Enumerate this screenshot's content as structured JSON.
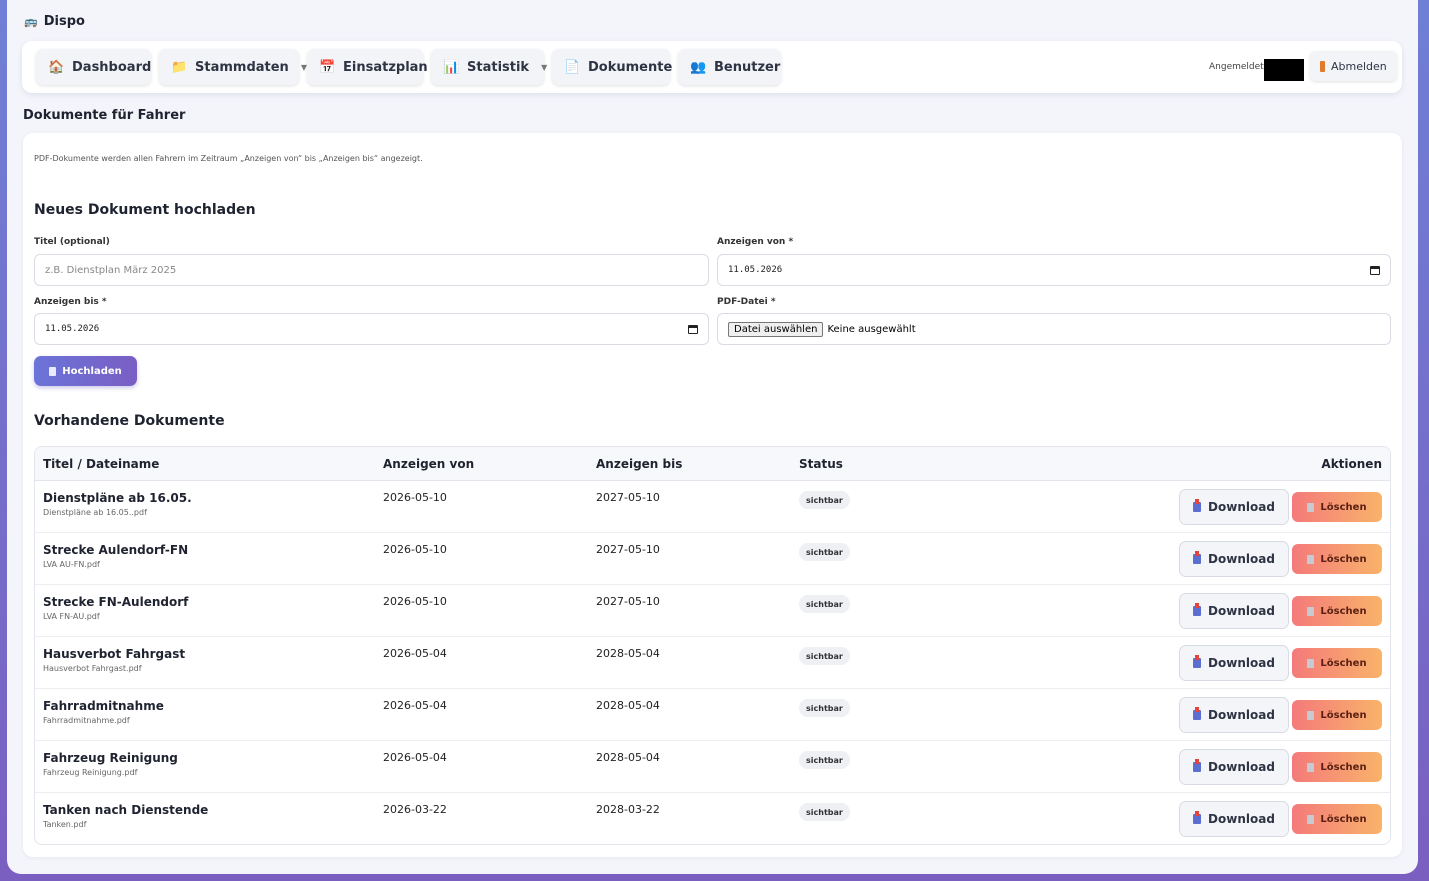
{
  "app": {
    "name": "Dispo"
  },
  "nav": {
    "items": [
      {
        "label": "Dashboard",
        "icon": "house-icon",
        "dropdown": false
      },
      {
        "label": "Stammdaten",
        "icon": "folder-icon",
        "dropdown": true
      },
      {
        "label": "Einsatzplan",
        "icon": "calendar-icon",
        "dropdown": false
      },
      {
        "label": "Statistik",
        "icon": "bar-chart-icon",
        "dropdown": true
      },
      {
        "label": "Dokumente",
        "icon": "document-icon",
        "dropdown": false
      },
      {
        "label": "Benutzer",
        "icon": "users-icon",
        "dropdown": false
      }
    ],
    "logged_in_label": "Angemeldet:",
    "logout_label": "Abmelden"
  },
  "page": {
    "title": "Dokumente für Fahrer",
    "hint": "PDF-Dokumente werden allen Fahrern im Zeitraum „Anzeigen von“ bis „Anzeigen bis“ angezeigt."
  },
  "upload": {
    "heading": "Neues Dokument hochladen",
    "title_label": "Titel (optional)",
    "title_placeholder": "z.B. Dienstplan März 2025",
    "from_label": "Anzeigen von *",
    "from_value": "11.05.2026",
    "until_label": "Anzeigen bis *",
    "until_value": "11.05.2026",
    "file_label": "PDF-Datei *",
    "file_button": "Datei auswählen",
    "file_none": "Keine ausgewählt",
    "submit_label": "Hochladen"
  },
  "documents": {
    "heading": "Vorhandene Dokumente",
    "columns": [
      "Titel / Dateiname",
      "Anzeigen von",
      "Anzeigen bis",
      "Status",
      "Aktionen"
    ],
    "download_label": "Download",
    "delete_label": "Löschen",
    "rows": [
      {
        "title": "Dienstpläne ab 16.05.",
        "file": "Dienstpläne ab 16.05..pdf",
        "from": "2026-05-10",
        "until": "2027-05-10",
        "status": "sichtbar"
      },
      {
        "title": "Strecke Aulendorf-FN",
        "file": "LVA AU-FN.pdf",
        "from": "2026-05-10",
        "until": "2027-05-10",
        "status": "sichtbar"
      },
      {
        "title": "Strecke FN-Aulendorf",
        "file": "LVA FN-AU.pdf",
        "from": "2026-05-10",
        "until": "2027-05-10",
        "status": "sichtbar"
      },
      {
        "title": "Hausverbot Fahrgast",
        "file": "Hausverbot Fahrgast.pdf",
        "from": "2026-05-04",
        "until": "2028-05-04",
        "status": "sichtbar"
      },
      {
        "title": "Fahrradmitnahme",
        "file": "Fahrradmitnahme.pdf",
        "from": "2026-05-04",
        "until": "2028-05-04",
        "status": "sichtbar"
      },
      {
        "title": "Fahrzeug Reinigung",
        "file": "Fahrzeug Reinigung.pdf",
        "from": "2026-05-04",
        "until": "2028-05-04",
        "status": "sichtbar"
      },
      {
        "title": "Tanken nach Dienstende",
        "file": "Tanken.pdf",
        "from": "2026-03-22",
        "until": "2028-03-22",
        "status": "sichtbar"
      }
    ]
  }
}
